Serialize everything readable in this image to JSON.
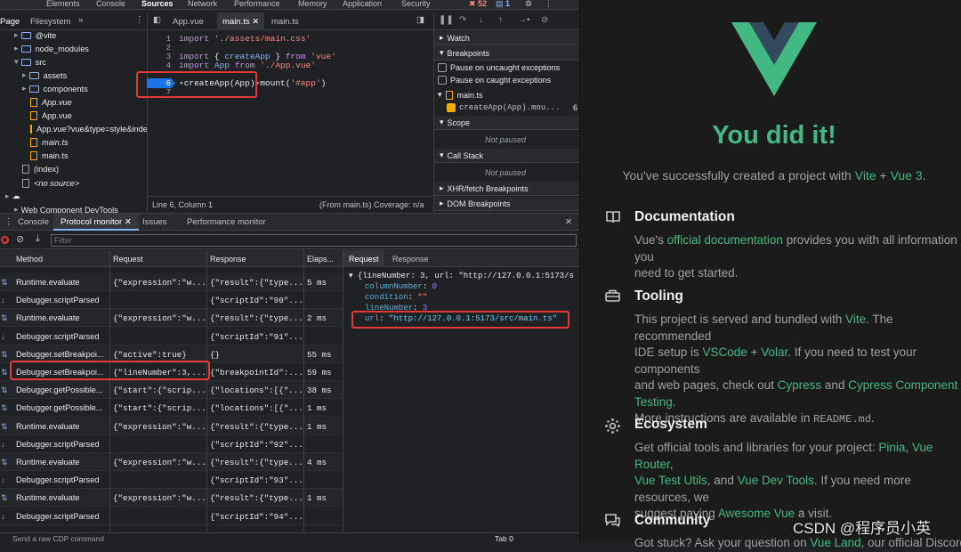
{
  "devtools": {
    "tabs": [
      "Elements",
      "Console",
      "Sources",
      "Network",
      "Performance",
      "Memory",
      "Application",
      "Security"
    ],
    "badges": {
      "errors": "52",
      "messages": "1"
    },
    "navigator": {
      "tabs": [
        "Page",
        "Filesystem"
      ],
      "items": [
        "@vite",
        "node_modules",
        "src",
        "assets",
        "components",
        "App.vue",
        "App.vue",
        "App.vue?vue&type=style&index",
        "main.ts",
        "main.ts",
        "(index)",
        "<no source>",
        "Web Component DevTools"
      ]
    },
    "editor_tabs": [
      "App.vue",
      "main.ts",
      "main.ts"
    ],
    "code": [
      {
        "n": "1",
        "t": "import './assets/main.css'"
      },
      {
        "n": "2",
        "t": ""
      },
      {
        "n": "3",
        "t": "import { createApp } from 'vue'"
      },
      {
        "n": "4",
        "t": "import App from './App.vue'"
      },
      {
        "n": "5",
        "t": ""
      },
      {
        "n": "6",
        "t": "createApp(App).mount('#app')"
      },
      {
        "n": "7",
        "t": ""
      }
    ],
    "status": {
      "pos": "Line 6, Column 1",
      "from": "(From main.ts) Coverage: n/a"
    },
    "debugger": {
      "watch": "Watch",
      "breakpoints": "Breakpoints",
      "pause_uncaught": "Pause on uncaught exceptions",
      "pause_caught": "Pause on caught exceptions",
      "bp_file": "main.ts",
      "bp_code": "createApp(App).mou...",
      "bp_line": "6",
      "scope": "Scope",
      "not_paused": "Not paused",
      "call_stack": "Call Stack",
      "xhr": "XHR/fetch Breakpoints",
      "dom": "DOM Breakpoints"
    },
    "drawer": {
      "tabs": [
        "Console",
        "Protocol monitor",
        "Issues",
        "Performance monitor"
      ],
      "filter_placeholder": "Filter",
      "headers": [
        "Method",
        "Request",
        "Response",
        "Elaps..."
      ],
      "rows": [
        [
          "Runtime.evaluate",
          "{\"expression\":\"w...",
          "{\"result\":{\"type...",
          "5 ms"
        ],
        [
          "Debugger.scriptParsed",
          "",
          "{\"scriptId\":\"90\"...",
          ""
        ],
        [
          "Runtime.evaluate",
          "{\"expression\":\"w...",
          "{\"result\":{\"type...",
          "2 ms"
        ],
        [
          "Debugger.scriptParsed",
          "",
          "{\"scriptId\":\"91\"...",
          ""
        ],
        [
          "Debugger.setBreakpoi...",
          "{\"active\":true}",
          "{}",
          "55 ms"
        ],
        [
          "Debugger.setBreakpoi...",
          "{\"lineNumber\":3,...",
          "{\"breakpointId\":...",
          "59 ms"
        ],
        [
          "Debugger.getPossible...",
          "{\"start\":{\"scrip...",
          "{\"locations\":[{\"...",
          "38 ms"
        ],
        [
          "Debugger.getPossible...",
          "{\"start\":{\"scrip...",
          "{\"locations\":[{\"...",
          "1 ms"
        ],
        [
          "Runtime.evaluate",
          "{\"expression\":\"w...",
          "{\"result\":{\"type...",
          "1 ms"
        ],
        [
          "Debugger.scriptParsed",
          "",
          "{\"scriptId\":\"92\"...",
          ""
        ],
        [
          "Runtime.evaluate",
          "{\"expression\":\"w...",
          "{\"result\":{\"type...",
          "4 ms"
        ],
        [
          "Debugger.scriptParsed",
          "",
          "{\"scriptId\":\"93\"...",
          ""
        ],
        [
          "Runtime.evaluate",
          "{\"expression\":\"w...",
          "{\"result\":{\"type...",
          "1 ms"
        ],
        [
          "Debugger.scriptParsed",
          "",
          "{\"scriptId\":\"94\"...",
          ""
        ]
      ],
      "detail_tabs": [
        "Request",
        "Response"
      ],
      "detail": {
        "summary": "{lineNumber: 3, url: \"http://127.0.0.1:5173/s",
        "columnNumber": "0",
        "condition": "\"\"",
        "lineNumber": "3",
        "url": "\"http://127.0.0.1:5173/src/main.ts\""
      },
      "command_placeholder": "Send a raw CDP command",
      "tab_target": "Tab 0"
    }
  },
  "app": {
    "title": "You did it!",
    "subtitle_pre": "You've successfully created a project with ",
    "vite": "Vite",
    "plus": " + ",
    "vue3": "Vue 3",
    "dot": ".",
    "sections": [
      {
        "heading": "Documentation",
        "lines": [
          "Vue's official documentation provides you with all information you",
          "need to get started."
        ]
      },
      {
        "heading": "Tooling",
        "lines": [
          "This project is served and bundled with Vite. The recommended",
          "IDE setup is VSCode + Volar. If you need to test your components",
          "and web pages, check out Cypress and Cypress Component",
          "Testing.",
          "More instructions are available in README.md."
        ]
      },
      {
        "heading": "Ecosystem",
        "lines": [
          "Get official tools and libraries for your project: Pinia, Vue Router,",
          "Vue Test Utils, and Vue Dev Tools. If you need more resources, we",
          "suggest paying Awesome Vue a visit."
        ]
      },
      {
        "heading": "Community",
        "lines": [
          "Got stuck? Ask your question on Vue Land, our official Discord"
        ]
      }
    ],
    "watermark": "CSDN @程序员小英",
    "colors": {
      "accent": "#42b883",
      "vue_dark": "#35495e"
    }
  }
}
